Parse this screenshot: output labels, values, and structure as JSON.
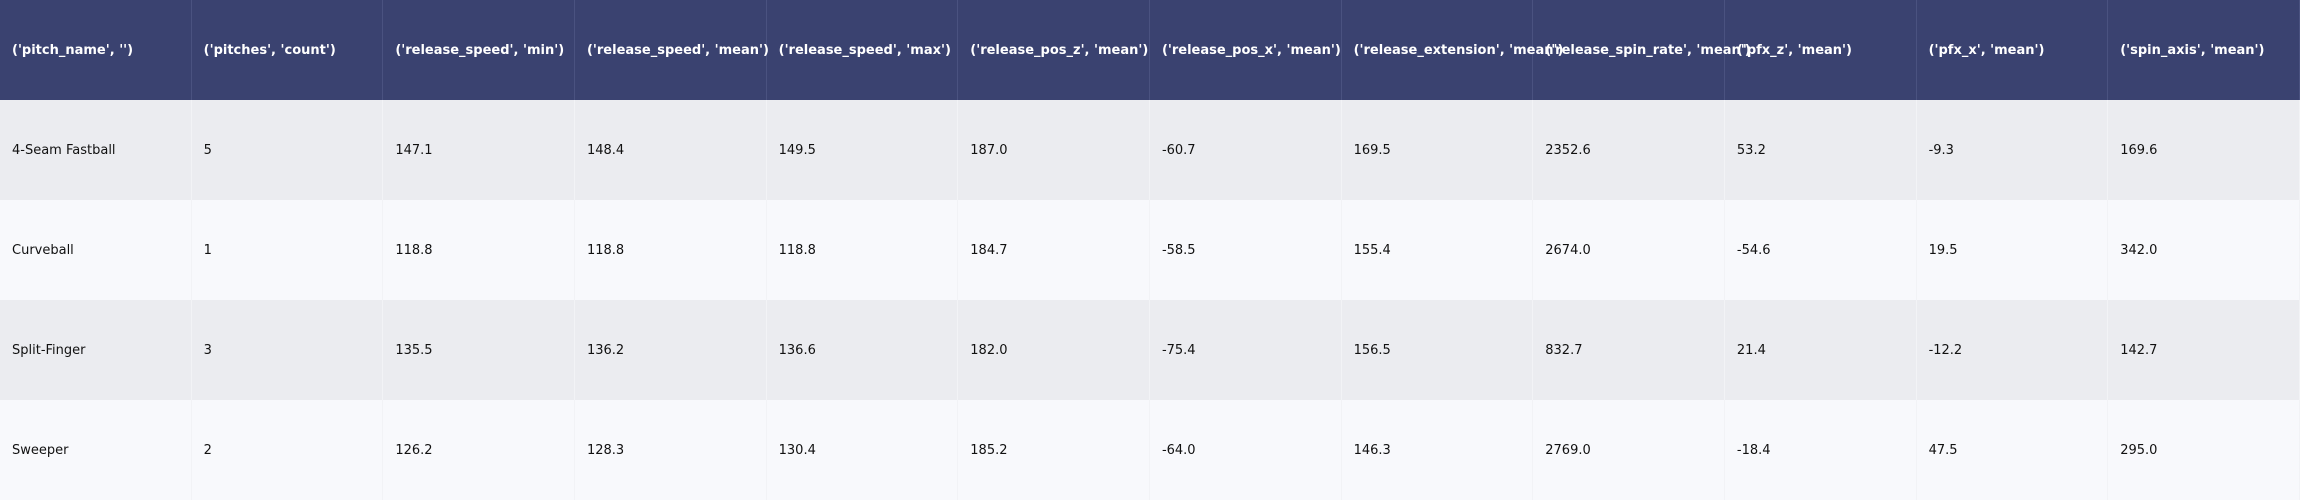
{
  "chart_data": {
    "type": "table",
    "columns": [
      "('pitch_name', '')",
      "('pitches', 'count')",
      "('release_speed', 'min')",
      "('release_speed', 'mean')",
      "('release_speed', 'max')",
      "('release_pos_z', 'mean')",
      "('release_pos_x', 'mean')",
      "('release_extension', 'mean')",
      "('release_spin_rate', 'mean')",
      "('pfx_z', 'mean')",
      "('pfx_x', 'mean')",
      "('spin_axis', 'mean')"
    ],
    "rows": [
      [
        "4-Seam Fastball",
        "5",
        "147.1",
        "148.4",
        "149.5",
        "187.0",
        "-60.7",
        "169.5",
        "2352.6",
        "53.2",
        "-9.3",
        "169.6"
      ],
      [
        "Curveball",
        "1",
        "118.8",
        "118.8",
        "118.8",
        "184.7",
        "-58.5",
        "155.4",
        "2674.0",
        "-54.6",
        "19.5",
        "342.0"
      ],
      [
        "Split-Finger",
        "3",
        "135.5",
        "136.2",
        "136.6",
        "182.0",
        "-75.4",
        "156.5",
        "832.7",
        "21.4",
        "-12.2",
        "142.7"
      ],
      [
        "Sweeper",
        "2",
        "126.2",
        "128.3",
        "130.4",
        "185.2",
        "-64.0",
        "146.3",
        "2769.0",
        "-18.4",
        "47.5",
        "295.0"
      ]
    ]
  },
  "colors": {
    "header_bg": "#3a4270",
    "header_text": "#ffffff",
    "row_even_bg": "#ebecf0",
    "row_odd_bg": "#f8f9fc",
    "body_text": "#111111"
  }
}
